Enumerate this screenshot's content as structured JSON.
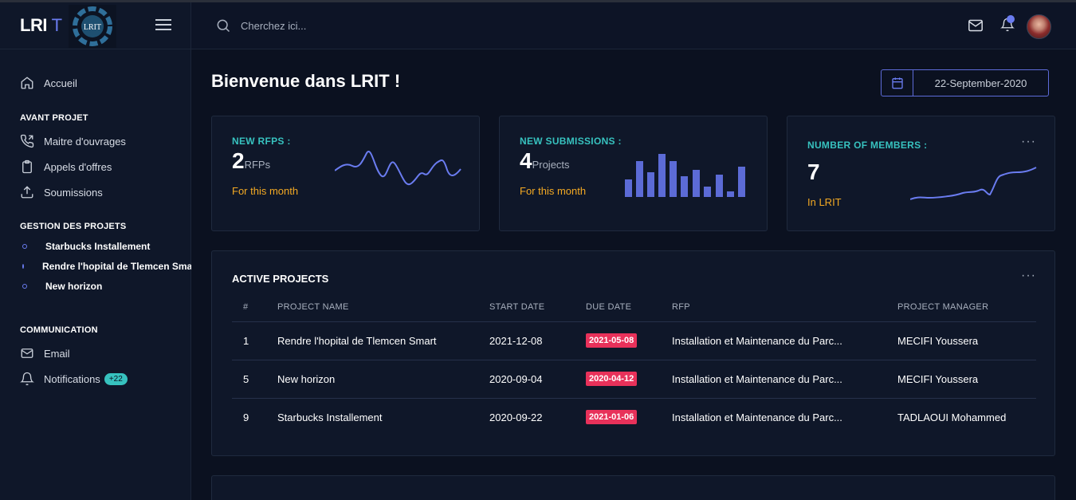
{
  "brand": {
    "name": "LRI",
    "name_suffix": "T",
    "logo_text": "LRIT"
  },
  "search": {
    "placeholder": "Cherchez ici..."
  },
  "sidebar": {
    "home_label": "Accueil",
    "section_avant": "AVANT PROJET",
    "avant_items": [
      "Maitre d'ouvrages",
      "Appels d'offres",
      "Soumissions"
    ],
    "section_gestion": "GESTION DES PROJETS",
    "projects": [
      "Starbucks Installement",
      "Rendre l'hopital de Tlemcen Smart",
      "New horizon"
    ],
    "section_comm": "COMMUNICATION",
    "email_label": "Email",
    "notifications_label": "Notifications",
    "notifications_badge": "+22"
  },
  "page": {
    "title": "Bienvenue dans LRIT !",
    "date": "22-September-2020"
  },
  "stats": {
    "rfps": {
      "title": "NEW RFPS :",
      "value": "2",
      "unit": "RFPs",
      "sub": "For this month"
    },
    "submissions": {
      "title": "NEW SUBMISSIONS :",
      "value": "4",
      "unit": "Projects",
      "sub": "For this month"
    },
    "members": {
      "title": "NUMBER OF MEMBERS :",
      "value": "7",
      "sub": "In LRIT"
    }
  },
  "table": {
    "title": "ACTIVE PROJECTS",
    "headers": [
      "#",
      "PROJECT NAME",
      "START DATE",
      "DUE DATE",
      "RFP",
      "PROJECT MANAGER"
    ],
    "rows": [
      [
        "1",
        "Rendre l'hopital de Tlemcen Smart",
        "2021-12-08",
        "2021-05-08",
        "Installation et Maintenance du Parc...",
        "MECIFI Youssera"
      ],
      [
        "5",
        "New horizon",
        "2020-09-04",
        "2020-04-12",
        "Installation et Maintenance du Parc...",
        "MECIFI Youssera"
      ],
      [
        "9",
        "Starbucks Installement",
        "2020-09-22",
        "2021-01-06",
        "Installation et Maintenance du Parc...",
        "TADLAOUI Mohammed"
      ]
    ]
  },
  "colors": {
    "accent": "#6a7cf0",
    "teal": "#37c2bf",
    "orange": "#f3a923",
    "due_red": "#e8315a",
    "background": "#0b1120",
    "card": "#0f1729"
  },
  "icons": [
    "search-icon",
    "mail-icon",
    "bell-icon",
    "home-icon",
    "phone-icon",
    "clipboard-icon",
    "upload-icon",
    "envelope-icon",
    "calendar-icon",
    "menu-icon"
  ]
}
